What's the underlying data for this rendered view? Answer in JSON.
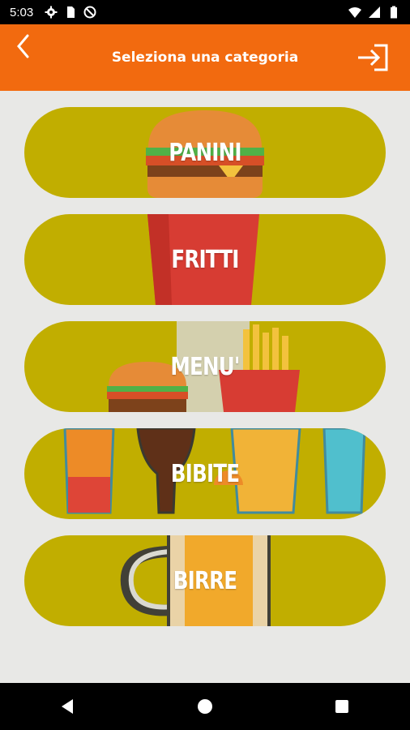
{
  "status_bar": {
    "time": "5:03",
    "icons_left": [
      "settings-icon",
      "sim-card-icon",
      "do-not-disturb-icon"
    ],
    "icons_right": [
      "wifi-icon",
      "signal-icon",
      "battery-icon"
    ]
  },
  "app_bar": {
    "title": "Seleziona una categoria",
    "back_icon": "chevron-left-icon",
    "logout_icon": "logout-arrow-icon",
    "background_color": "#f26a0f"
  },
  "categories": [
    {
      "label": "PANINI",
      "image": "burger"
    },
    {
      "label": "FRITTI",
      "image": "fries-box"
    },
    {
      "label": "MENU'",
      "image": "burger-and-fries"
    },
    {
      "label": "BIBITE",
      "image": "drink-glasses"
    },
    {
      "label": "BIRRE",
      "image": "beer-mug"
    }
  ],
  "colors": {
    "category_background": "#c1ae00",
    "page_background": "#e8e8e6",
    "label_color": "#ffffff"
  },
  "nav_bar": {
    "buttons": [
      "back-triangle-icon",
      "home-circle-icon",
      "recents-square-icon"
    ]
  }
}
